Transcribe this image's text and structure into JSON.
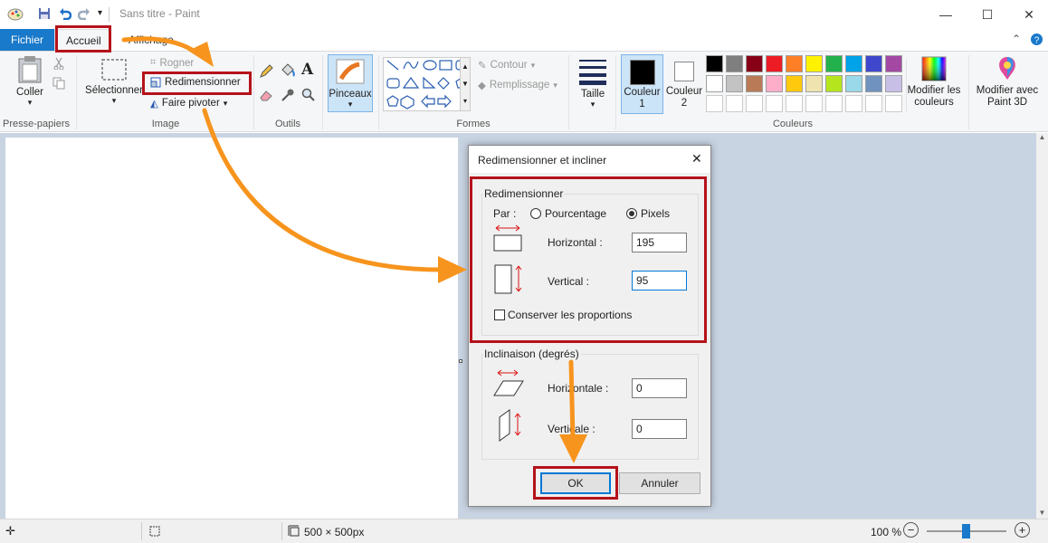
{
  "window": {
    "title": "Sans titre - Paint",
    "minimize": "—",
    "maximize": "☐",
    "close": "✕"
  },
  "tabs": {
    "file": "Fichier",
    "home": "Accueil",
    "view": "Affichage"
  },
  "ribbon": {
    "clipboard": {
      "paste": "Coller",
      "label": "Presse-papiers"
    },
    "image": {
      "select": "Sélectionner",
      "crop": "Rogner",
      "resize": "Redimensionner",
      "rotate": "Faire pivoter",
      "label": "Image"
    },
    "tools": {
      "label": "Outils",
      "text_glyph": "A"
    },
    "brushes": {
      "label": "Pinceaux"
    },
    "shapes": {
      "outline": "Contour",
      "fill": "Remplissage",
      "label": "Formes"
    },
    "size": {
      "label": "Taille"
    },
    "colors": {
      "color1": "Couleur 1",
      "color2": "Couleur 2",
      "label": "Couleurs",
      "edit": "Modifier les couleurs",
      "paint3d": "Modifier avec Paint 3D",
      "palette_row1": [
        "#000000",
        "#7f7f7f",
        "#880015",
        "#ed1c24",
        "#ff7f27",
        "#fff200",
        "#22b14c",
        "#00a2e8",
        "#3f48cc",
        "#a349a4"
      ],
      "palette_row2": [
        "#ffffff",
        "#c3c3c3",
        "#b97a57",
        "#ffaec9",
        "#ffc90e",
        "#efe4b0",
        "#b5e61d",
        "#99d9ea",
        "#7092be",
        "#c8bfe7"
      ],
      "color1_value": "#000000",
      "color2_value": "#ffffff"
    }
  },
  "status": {
    "image_size": "500 × 500px",
    "zoom": "100 %"
  },
  "dialog": {
    "title": "Redimensionner et incliner",
    "resize_legend": "Redimensionner",
    "by_label": "Par :",
    "percent_label": "Pourcentage",
    "pixels_label": "Pixels",
    "horizontal_label": "Horizontal :",
    "vertical_label": "Vertical :",
    "horizontal_value": "195",
    "vertical_value": "95",
    "keep_ratio": "Conserver les proportions",
    "skew_legend": "Inclinaison (degrés)",
    "skew_h_label": "Horizontale :",
    "skew_v_label": "Verticale :",
    "skew_h_value": "0",
    "skew_v_value": "0",
    "ok": "OK",
    "cancel": "Annuler"
  },
  "accent": {
    "highlight": "#b5121b",
    "arrow": "#f7941d",
    "ribbon_tab": "#1979ca"
  }
}
